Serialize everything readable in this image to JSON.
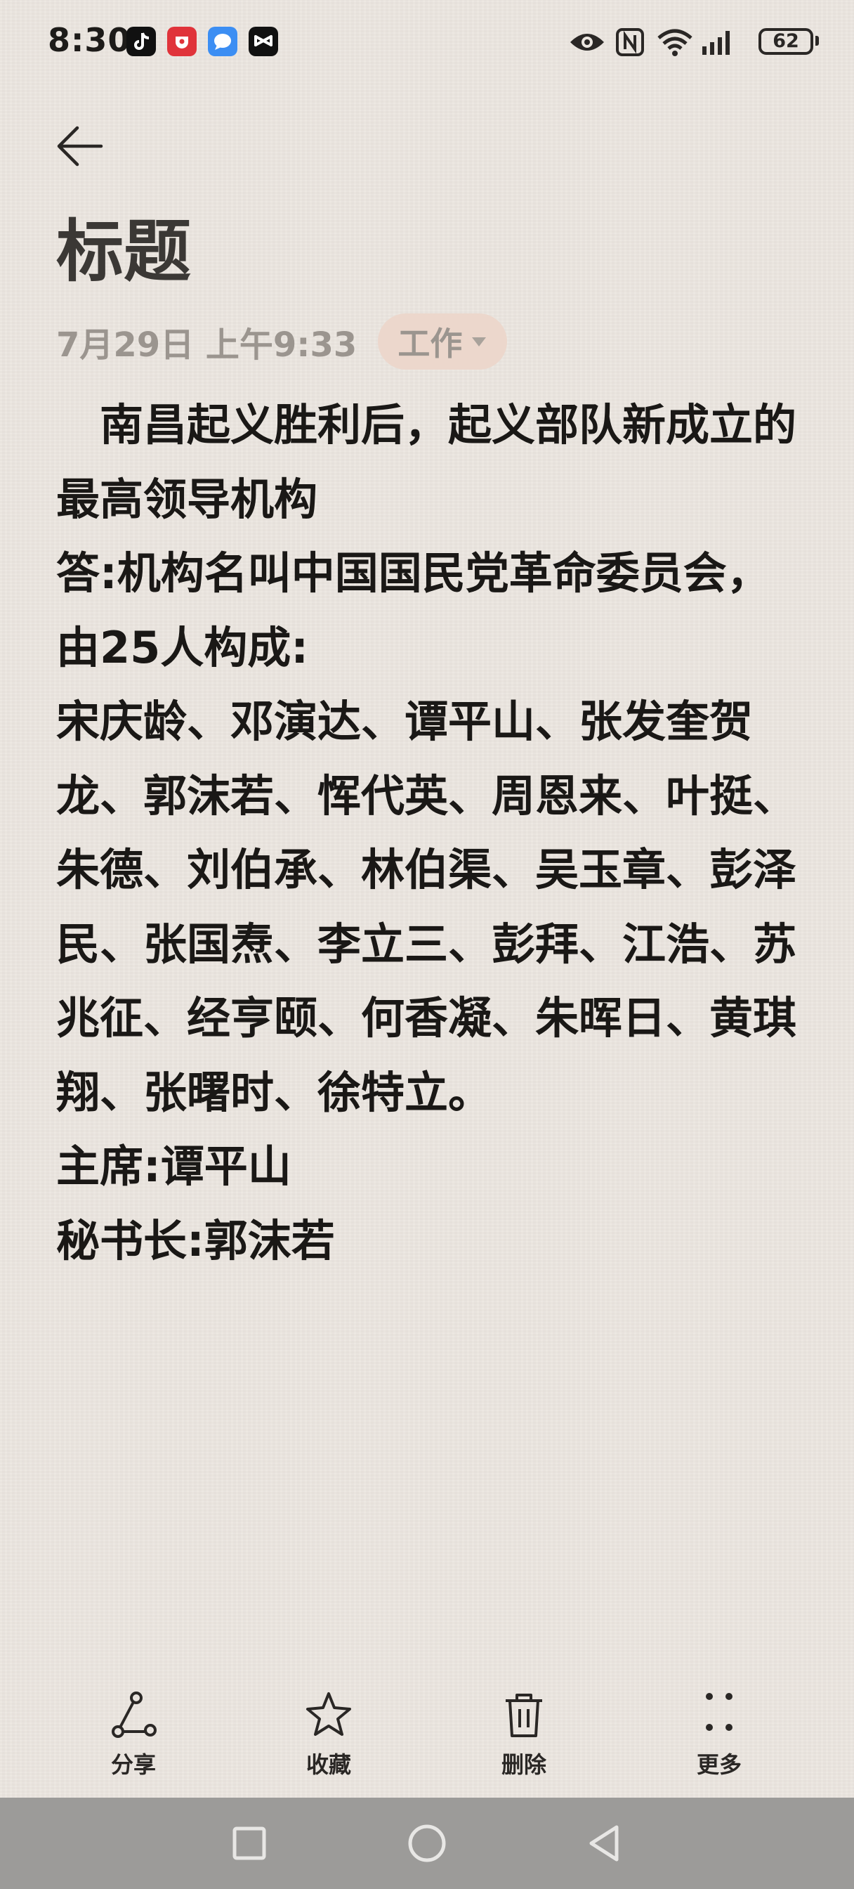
{
  "status_bar": {
    "time": "8:30",
    "battery_level": "62",
    "icons": [
      "tiktok-icon",
      "red-app-icon",
      "blue-chat-icon",
      "capcut-icon",
      "eye-icon",
      "nfc-icon",
      "wifi-icon",
      "signal-icon",
      "battery-icon"
    ]
  },
  "note": {
    "title": "标题",
    "date": "7月29日 上午9:33",
    "category": "工作",
    "body": "　南昌起义胜利后，起义部队新成立的最高领导机构\n答:机构名叫中国国民党革命委员会，由25人构成:\n宋庆龄、邓演达、谭平山、张发奎贺龙、郭沫若、恽代英、周恩来、叶挺、朱德、刘伯承、林伯渠、吴玉章、彭泽民、张国焘、李立三、彭拜、江浩、苏兆征、经亨颐、何香凝、朱晖日、黄琪翔、张曙时、徐特立。\n主席:谭平山\n秘书长:郭沫若"
  },
  "toolbar": {
    "share_label": "分享",
    "favorite_label": "收藏",
    "delete_label": "删除",
    "more_label": "更多"
  },
  "nav_bar": {
    "buttons": [
      "recents-icon",
      "home-icon",
      "back-triangle-icon"
    ]
  }
}
